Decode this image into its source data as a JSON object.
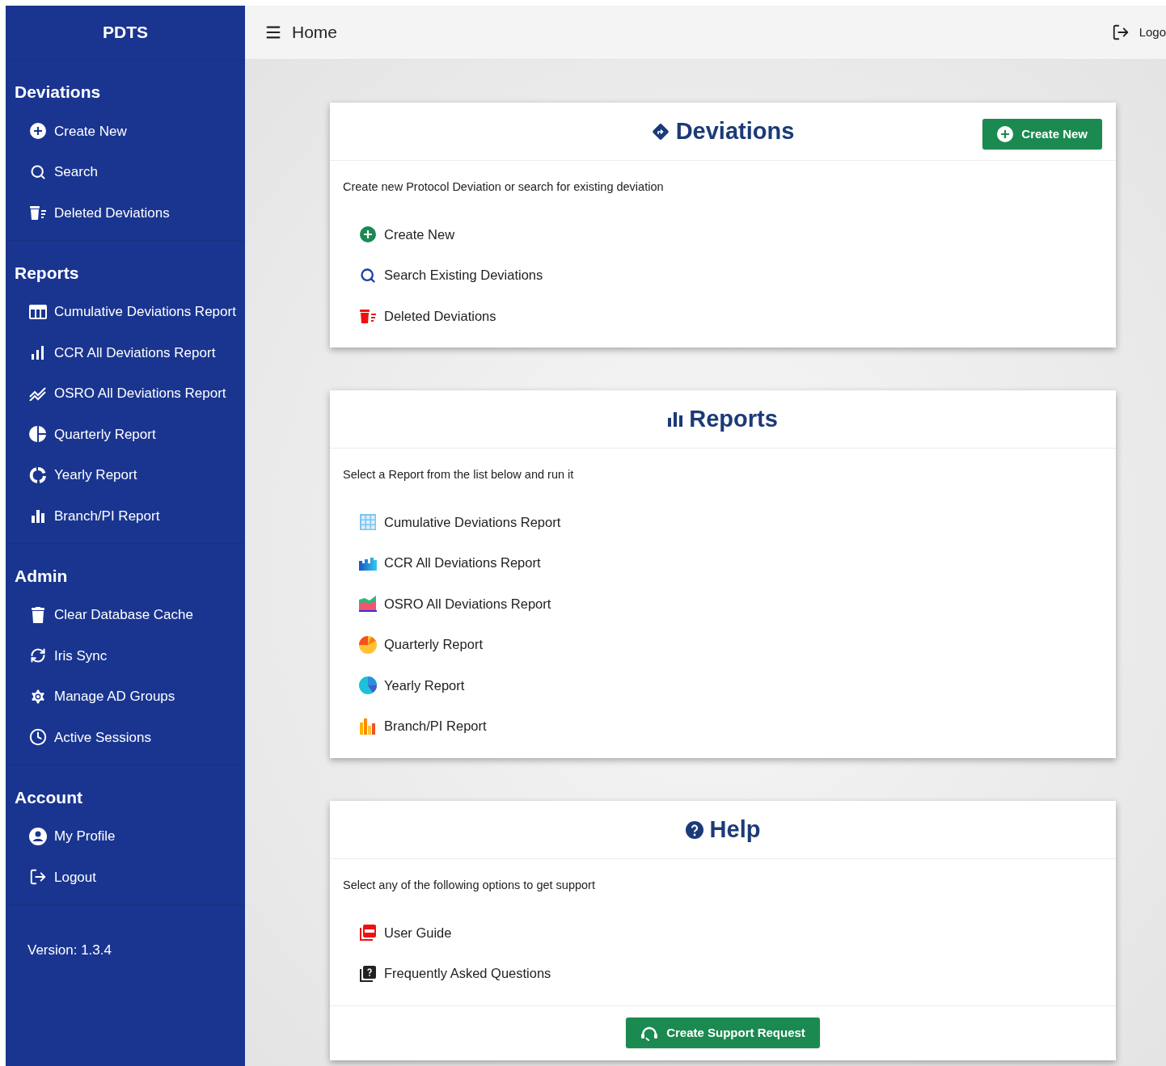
{
  "app_title": "PDTS",
  "sidebar": {
    "sections": [
      {
        "title": "Deviations",
        "items": [
          "Create New",
          "Search",
          "Deleted Deviations"
        ]
      },
      {
        "title": "Reports",
        "items": [
          "Cumulative Deviations Report",
          "CCR All Deviations Report",
          "OSRO All Deviations Report",
          "Quarterly Report",
          "Yearly Report",
          "Branch/PI Report"
        ]
      },
      {
        "title": "Admin",
        "items": [
          "Clear Database Cache",
          "Iris Sync",
          "Manage AD Groups",
          "Active Sessions"
        ]
      },
      {
        "title": "Account",
        "items": [
          "My Profile",
          "Logout"
        ]
      }
    ],
    "version": "Version: 1.3.4"
  },
  "topbar": {
    "title": "Home",
    "logout": "Logo"
  },
  "cards": [
    {
      "title": "Deviations",
      "button": "Create New",
      "description": "Create new Protocol Deviation or search for existing deviation",
      "items": [
        "Create New",
        "Search Existing Deviations",
        "Deleted Deviations"
      ]
    },
    {
      "title": "Reports",
      "description": "Select a Report from the list below and run it",
      "items": [
        "Cumulative Deviations Report",
        "CCR All Deviations Report",
        "OSRO All Deviations Report",
        "Quarterly Report",
        "Yearly Report",
        "Branch/PI Report"
      ]
    },
    {
      "title": "Help",
      "description": "Select any of the following options to get support",
      "items": [
        "User Guide",
        "Frequently Asked Questions"
      ],
      "footer_button": "Create Support Request"
    }
  ]
}
